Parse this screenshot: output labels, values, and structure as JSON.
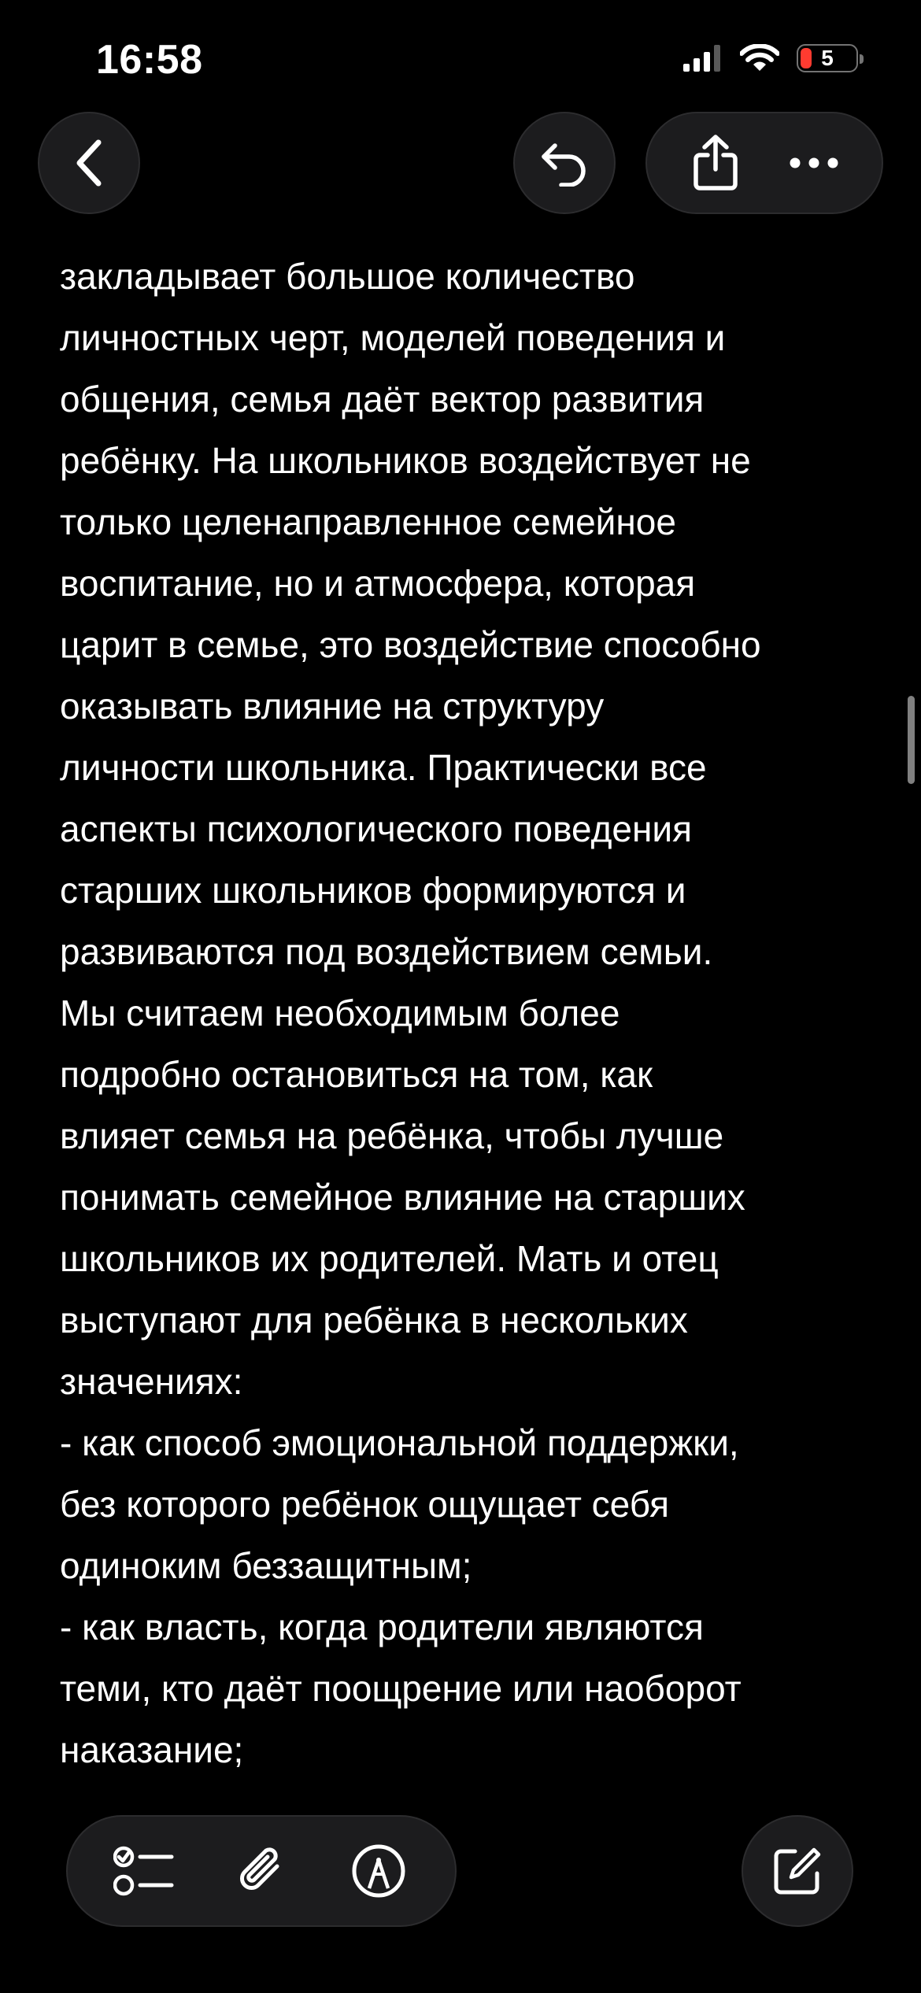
{
  "status_bar": {
    "time": "16:58",
    "battery_level": "5",
    "icons": [
      "signal-icon",
      "wifi-icon",
      "battery-icon"
    ]
  },
  "nav": {
    "back_icon": "chevron-left-icon",
    "undo_icon": "undo-icon",
    "share_icon": "share-icon",
    "more_icon": "ellipsis-icon"
  },
  "note": {
    "lines": [
      "закладывает большое количество",
      "личностных черт, моделей поведения и",
      "общения, семья даёт вектор развития",
      "ребёнку. На школьников воздействует не",
      "только целенаправленное семейное",
      "воспитание, но и атмосфера, которая",
      "царит в семье, это воздействие способно",
      "оказывать влияние на структуру",
      "личности школьника. Практически все",
      "аспекты психологического поведения",
      "старших школьников формируются и",
      "развиваются под воздействием семьи.",
      "Мы считаем необходимым более",
      "подробно остановиться на том, как",
      "влияет семья на ребёнка, чтобы лучше",
      "понимать семейное влияние на старших",
      "школьников их родителей. Мать и отец",
      "выступают для ребёнка в нескольких",
      "значениях:",
      "- как способ эмоциональной поддержки,",
      "без которого ребёнок ощущает себя",
      "одиноким беззащитным;",
      "- как власть, когда родители являются",
      "теми, кто даёт поощрение или наоборот",
      "наказание;"
    ]
  },
  "toolbar": {
    "checklist_icon": "checklist-icon",
    "attach_icon": "paperclip-icon",
    "markup_icon": "markup-pen-icon",
    "compose_icon": "compose-icon"
  },
  "colors": {
    "background": "#000000",
    "text": "#ffffff",
    "button_bg": "#1c1c1e",
    "battery_low": "#ff3b30"
  }
}
